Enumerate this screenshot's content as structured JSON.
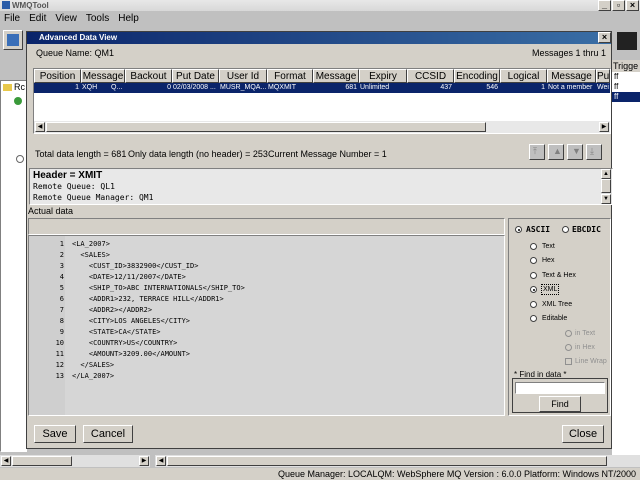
{
  "app": {
    "title": "WMQTool",
    "menu": [
      "File",
      "Edit",
      "View",
      "Tools",
      "Help"
    ],
    "right_panel_header": "Trigge",
    "right_panel_rows": [
      "ff",
      "ff",
      "ff"
    ],
    "tree_root": "Rc",
    "status_bar": "Queue Manager: LOCALQM: WebSphere MQ Version : 6.0.0 Platform: Windows NT/2000"
  },
  "dialog": {
    "title": "Advanced Data View",
    "queue_name_label": "Queue Name: QM1",
    "messages_label": "Messages 1 thru 1",
    "table": {
      "columns": [
        "Position",
        "Message",
        "Backout",
        "Put Date",
        "User Id",
        "Format",
        "Message",
        "Expiry",
        "CCSID",
        "Encoding",
        "Logical",
        "Message",
        "Pu"
      ],
      "rows": [
        [
          "1",
          "XQH",
          "Q...",
          "0",
          "02/03/2008 ...",
          "MUSR_MQA...",
          "MQXMIT",
          "681",
          "Unlimited",
          "437",
          "546",
          "1",
          "Not a member",
          "Wei"
        ]
      ]
    },
    "info": {
      "total": "Total data length = 681",
      "only": "Only data length (no header) = 253",
      "current": "Current Message Number = 1"
    },
    "header_panel": {
      "title": "Header = XMIT",
      "lines": [
        "Remote Queue: QL1",
        "Remote Queue Manager: QM1"
      ]
    },
    "actual_data_label": "Actual data",
    "code_lines": [
      {
        "n": "1",
        "t": "<LA_2007>"
      },
      {
        "n": "2",
        "t": "  <SALES>"
      },
      {
        "n": "3",
        "t": "    <CUST_ID>3832900</CUST_ID>"
      },
      {
        "n": "4",
        "t": "    <DATE>12/11/2007</DATE>"
      },
      {
        "n": "5",
        "t": "    <SHIP_TO>ABC INTERNATIONALS</SHIP_TO>"
      },
      {
        "n": "6",
        "t": "    <ADDR1>232, TERRACE HILL</ADDR1>"
      },
      {
        "n": "7",
        "t": "    <ADDR2></ADDR2>"
      },
      {
        "n": "8",
        "t": "    <CITY>LOS ANGELES</CITY>"
      },
      {
        "n": "9",
        "t": "    <STATE>CA</STATE>"
      },
      {
        "n": "10",
        "t": "    <COUNTRY>US</COUNTRY>"
      },
      {
        "n": "11",
        "t": "    <AMOUNT>3209.00</AMOUNT>"
      },
      {
        "n": "12",
        "t": "  </SALES>"
      },
      {
        "n": "13",
        "t": "</LA_2007>"
      }
    ],
    "options": {
      "encoding": [
        "ASCII",
        "EBCDIC"
      ],
      "formats": [
        "Text",
        "Hex",
        "Text & Hex",
        "XML",
        "XML Tree",
        "Editable"
      ],
      "sub": [
        "in Text",
        "in Hex",
        "Line Wrap"
      ],
      "find_label": "* Find in data *",
      "find_value": "",
      "find_button": "Find"
    },
    "buttons": {
      "save": "Save",
      "cancel": "Cancel",
      "close": "Close"
    }
  }
}
